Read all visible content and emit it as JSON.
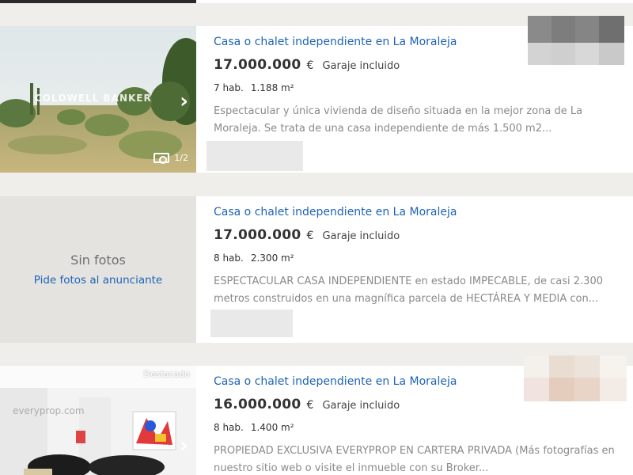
{
  "listings": [
    {
      "title": "Casa o chalet independiente en La Moraleja",
      "price": "17.000.000",
      "currency": "€",
      "garage": "Garaje incluido",
      "rooms": "7 hab.",
      "area": "1.188 m²",
      "description": "Espectacular y única vivienda de diseño situada en la mejor zona de La Moraleja. Se trata de una casa independiente de más 1.500 m2...",
      "photo_watermark": "COLDWELL BANKER",
      "photo_counter": "1/2"
    },
    {
      "title": "Casa o chalet independiente en La Moraleja",
      "price": "17.000.000",
      "currency": "€",
      "garage": "Garaje incluido",
      "rooms": "8 hab.",
      "area": "2.300 m²",
      "description": "ESPECTACULAR CASA INDEPENDIENTE en estado IMPECABLE, de casi 2.300 metros construidos en una magnífica parcela de HECTÁREA Y MEDIA con...",
      "no_photos": "Sin fotos",
      "request_photos": "Pide fotos al anunciante"
    },
    {
      "title": "Casa o chalet independiente en La Moraleja",
      "price": "16.000.000",
      "currency": "€",
      "garage": "Garaje incluido",
      "rooms": "8 hab.",
      "area": "1.400 m²",
      "description": "PROPIEDAD EXCLUSIVA EVERYPROP EN CARTERA PRIVADA (Más fotografías en nuestro sitio web o visite el inmueble con su Broker...",
      "badge": "Destacado",
      "photo_watermark": "everyprop.com"
    }
  ],
  "icons": {
    "next_photo": "chevron-right-icon",
    "camera": "camera-icon"
  },
  "colors": {
    "link": "#1e63b5",
    "background": "#efeeea",
    "card": "#ffffff",
    "description": "#8a8a8a"
  }
}
